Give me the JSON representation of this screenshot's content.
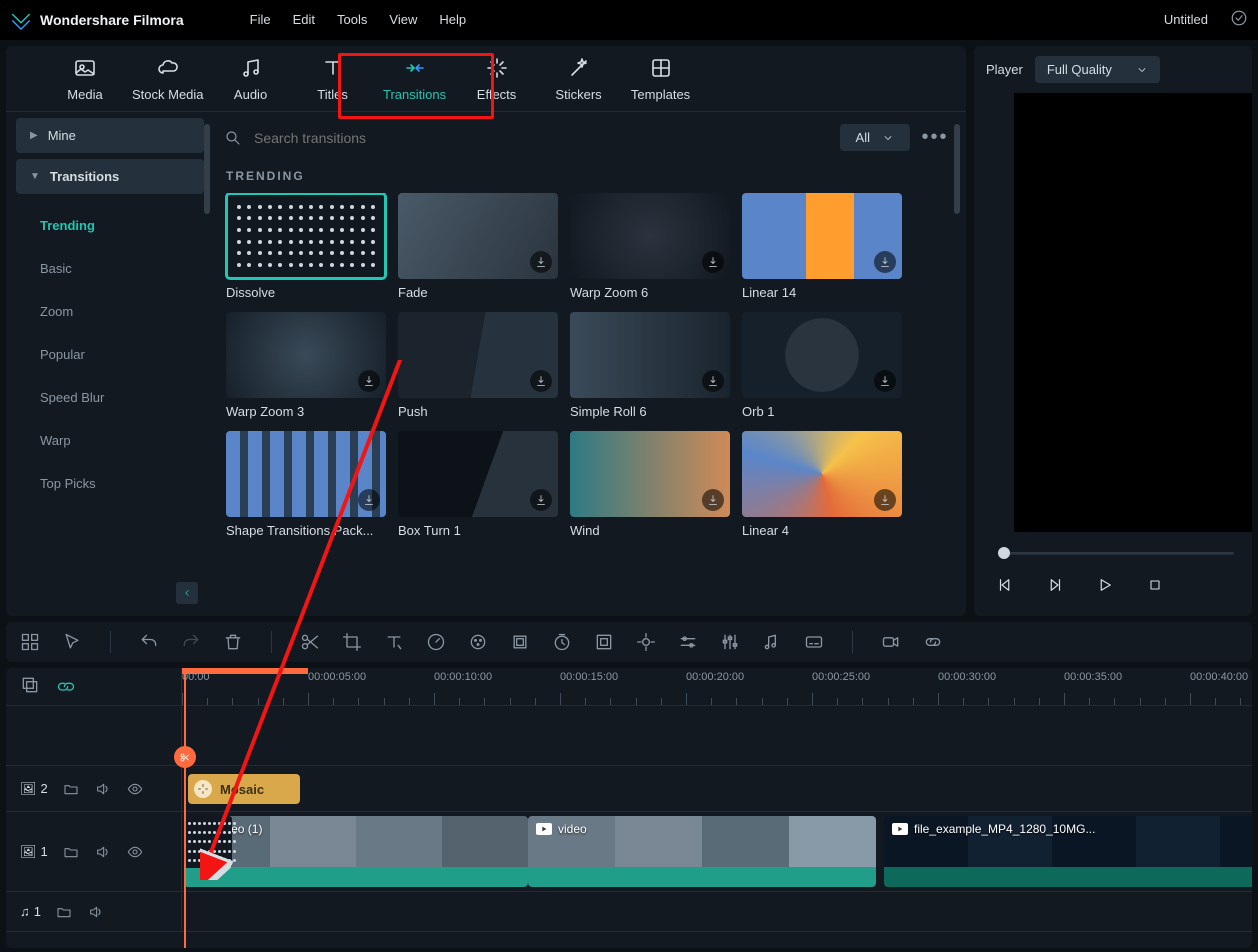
{
  "app": {
    "name": "Wondershare Filmora"
  },
  "menus": [
    "File",
    "Edit",
    "Tools",
    "View",
    "Help"
  ],
  "doc": {
    "name": "Untitled"
  },
  "tabs": [
    {
      "id": "media",
      "label": "Media"
    },
    {
      "id": "stock",
      "label": "Stock Media"
    },
    {
      "id": "audio",
      "label": "Audio"
    },
    {
      "id": "titles",
      "label": "Titles"
    },
    {
      "id": "transitions",
      "label": "Transitions",
      "active": true
    },
    {
      "id": "effects",
      "label": "Effects"
    },
    {
      "id": "stickers",
      "label": "Stickers"
    },
    {
      "id": "templates",
      "label": "Templates"
    }
  ],
  "sidebar": {
    "mine": "Mine",
    "transitions": "Transitions",
    "items": [
      {
        "label": "Trending",
        "active": true
      },
      {
        "label": "Basic"
      },
      {
        "label": "Zoom"
      },
      {
        "label": "Popular"
      },
      {
        "label": "Speed Blur"
      },
      {
        "label": "Warp"
      },
      {
        "label": "Top Picks"
      }
    ]
  },
  "search": {
    "placeholder": "Search transitions",
    "filter": "All"
  },
  "gallery": {
    "section": "TRENDING",
    "items": [
      {
        "label": "Dissolve",
        "selected": true
      },
      {
        "label": "Fade"
      },
      {
        "label": "Warp Zoom 6"
      },
      {
        "label": "Linear 14"
      },
      {
        "label": "Warp Zoom 3"
      },
      {
        "label": "Push"
      },
      {
        "label": "Simple Roll 6"
      },
      {
        "label": "Orb 1"
      },
      {
        "label": "Shape Transitions Pack..."
      },
      {
        "label": "Box Turn 1"
      },
      {
        "label": "Wind"
      },
      {
        "label": "Linear 4"
      }
    ]
  },
  "player": {
    "title": "Player",
    "quality": "Full Quality"
  },
  "timeline": {
    "ruler": [
      "00:00",
      "00:00:05:00",
      "00:00:10:00",
      "00:00:15:00",
      "00:00:20:00",
      "00:00:25:00",
      "00:00:30:00",
      "00:00:35:00",
      "00:00:40:00"
    ],
    "track_fx_label": "Mosaic",
    "clip1_label": "Video (1)",
    "clip2_label": "video",
    "clip3_label": "file_example_MP4_1280_10MG...",
    "picture_track": "2",
    "video_track": "1",
    "audio_track": "1",
    "picture_glyph": "🖼",
    "audio_glyph": "♫"
  }
}
